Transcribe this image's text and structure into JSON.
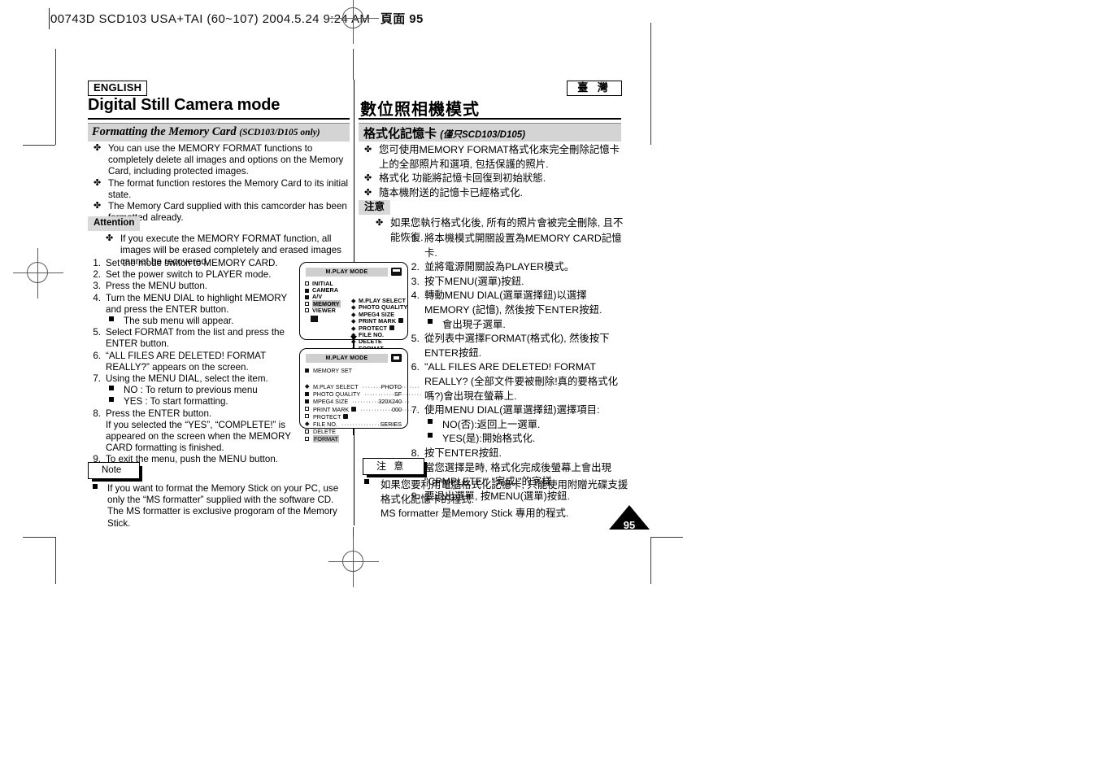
{
  "print_header": {
    "filename_line": "00743D SCD103 USA+TAI (60~107)   2004.5.24   9:24 AM",
    "cjk_suffix": "頁面 95"
  },
  "left_column": {
    "language_badge": "ENGLISH",
    "page_title": "Digital Still Camera mode",
    "section_title": "Formatting the Memory Card",
    "section_title_sub": "(SCD103/D105 only)",
    "bullets": [
      "You can use the MEMORY FORMAT functions to completely delete all images and options on the Memory Card, including protected images.",
      "The format function restores the Memory Card to its initial state.",
      "The Memory Card supplied with this camcorder has been formatted already."
    ],
    "attention_label": "Attention",
    "attention_text": "If you execute the MEMORY FORMAT function, all images will be erased completely and erased images cannot be recovered.",
    "steps": [
      {
        "text": "Set the mode switch to MEMORY CARD.",
        "subs": []
      },
      {
        "text": "Set the power switch to PLAYER mode.",
        "subs": []
      },
      {
        "text": "Press the MENU button.",
        "subs": []
      },
      {
        "text": "Turn the MENU DIAL to highlight MEMORY and press the ENTER button.",
        "subs": [
          "The sub menu will appear."
        ]
      },
      {
        "text": "Select FORMAT from the list and press the ENTER button.",
        "subs": []
      },
      {
        "text": "“ALL FILES ARE DELETED! FORMAT REALLY?” appears on the screen.",
        "subs": []
      },
      {
        "text": "Using the MENU DIAL, select the item.",
        "subs": [
          "NO : To return to previous menu",
          "YES : To start formatting."
        ]
      },
      {
        "text": "Press the ENTER button.\nIf you selected the “YES”, “COMPLETE!” is appeared on the screen when the MEMORY CARD formatting is finished.",
        "subs": []
      },
      {
        "text": "To exit the menu, push the MENU button.",
        "subs": []
      }
    ],
    "note_label": "Note",
    "note_text": "If you want to format the Memory Stick on your PC, use only the “MS formatter” supplied with the software CD.\nThe MS formatter is exclusive progoram of the Memory Stick."
  },
  "right_column": {
    "language_badge": "臺 灣",
    "page_title": "數位照相機模式",
    "section_title": "格式化記憶卡",
    "section_title_sub": "(僅只SCD103/D105)",
    "bullets": [
      "您可使用MEMORY FORMAT格式化來完全刪除記憶卡上的全部照片和選項, 包括保護的照片.",
      "格式化 功能將記憶卡回復到初始狀態.",
      "隨本機附送的記憶卡已經格式化."
    ],
    "attention_label": "注意",
    "attention_text": "如果您執行格式化後, 所有的照片會被完全刪除, 且不能恢復.",
    "steps": [
      {
        "text": "將本機模式開關設置為MEMORY CARD記憶卡.",
        "subs": []
      },
      {
        "text": "並將電源開關設為PLAYER模式。",
        "subs": []
      },
      {
        "text": "按下MENU(選單)按鈕.",
        "subs": []
      },
      {
        "text": "轉動MENU DIAL(選單選擇鈕)以選擇MEMORY (記憶), 然後按下ENTER按鈕.",
        "subs": [
          "會出現子選單."
        ]
      },
      {
        "text": "從列表中選擇FORMAT(格式化), 然後按下 ENTER按鈕.",
        "subs": []
      },
      {
        "text": "\"ALL FILES ARE DELETED! FORMAT REALLY? (全部文件要被刪除!真的要格式化嗎?)會出現在螢幕上.",
        "subs": []
      },
      {
        "text": "使用MENU DIAL(選單選擇鈕)選擇項目:",
        "subs": [
          "NO(否):返回上一選單.",
          "YES(是):開始格式化."
        ]
      },
      {
        "text": "按下ENTER按鈕.\n當您選擇是時, 格式化完成後螢幕上會出現 \"CPMPLETE!\" \"完成!\"的字樣.",
        "subs": []
      },
      {
        "text": "要退出選單, 按MENU(選單)按鈕.",
        "subs": []
      }
    ],
    "note_label": "注 意",
    "note_text": "如果您要利用電腦格式化記憶卡, 只能使用附贈光碟支援格式化記憶卡的程式.\nMS formatter 是Memory Stick 專用的程式."
  },
  "lcd_top": {
    "header": "M.PLAY MODE",
    "card_icon": "memory-card-icon",
    "left_items": [
      "INITIAL",
      "CAMERA",
      "A/V",
      "MEMORY",
      "VIEWER"
    ],
    "highlighted_left": "MEMORY",
    "right_items": [
      "M.PLAY SELECT",
      "PHOTO QUALITY",
      "MPEG4 SIZE",
      "PRINT MARK",
      "PROTECT",
      "FILE NO.",
      "DELETE",
      "FORMAT"
    ]
  },
  "lcd_bottom": {
    "header": "M.PLAY MODE",
    "card_icon": "memory-card-icon",
    "group_label": "MEMORY SET",
    "rows": [
      {
        "label": "M.PLAY SELECT",
        "value": "PHOTO"
      },
      {
        "label": "PHOTO QUALITY",
        "value": "SF"
      },
      {
        "label": "MPEG4 SIZE",
        "value": "320X240"
      },
      {
        "label": "PRINT MARK",
        "value": "000"
      },
      {
        "label": "PROTECT",
        "value": ""
      },
      {
        "label": "FILE NO.",
        "value": "SERIES"
      },
      {
        "label": "DELETE",
        "value": ""
      },
      {
        "label": "FORMAT",
        "value": ""
      }
    ],
    "highlighted_row": "FORMAT"
  },
  "page_number": "95"
}
